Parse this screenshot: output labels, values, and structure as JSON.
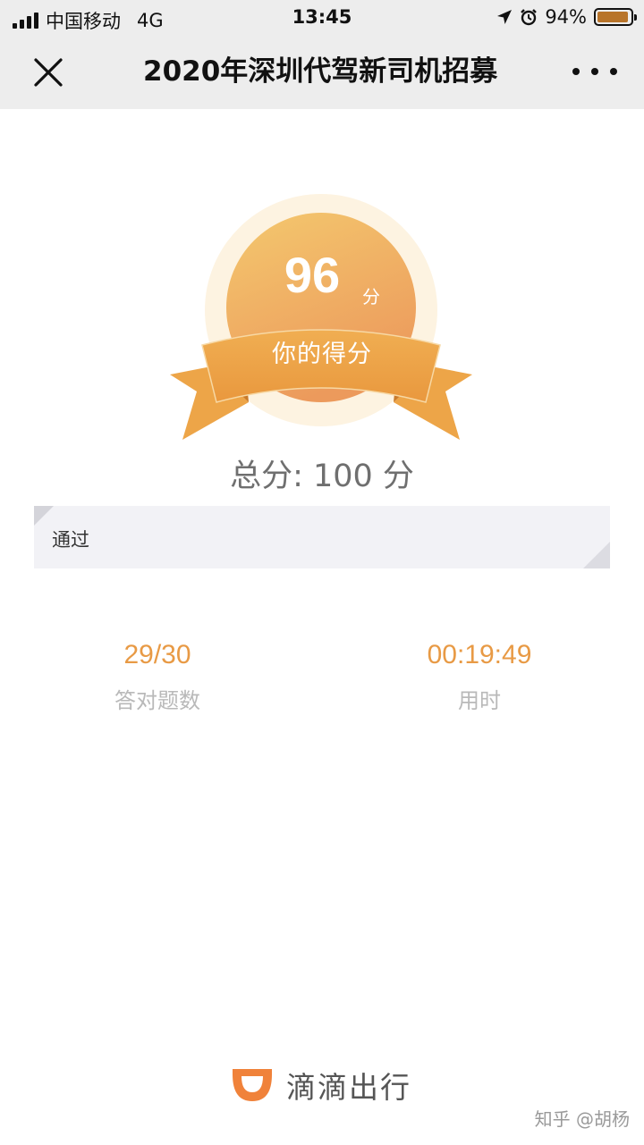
{
  "status_bar": {
    "carrier": "中国移动",
    "network": "4G",
    "time": "13:45",
    "battery": "94%",
    "battery_level": 0.94,
    "icons": [
      "signal-icon",
      "location-arrow-icon",
      "alarm-clock-icon",
      "battery-icon"
    ]
  },
  "nav": {
    "title": "2020年深圳代驾新司机招募",
    "close_icon": "close-icon",
    "more_icon": "more-dots-icon"
  },
  "score": {
    "value": "96",
    "unit": "分",
    "label": "你的得分",
    "total": "总分: 100 分"
  },
  "result": {
    "text": "通过"
  },
  "stats": [
    {
      "value": "29/30",
      "label": "答对题数"
    },
    {
      "value": "00:19:49",
      "label": "用时"
    }
  ],
  "footer": {
    "brand": "滴滴出行",
    "logo": "didi-logo-icon"
  },
  "watermark": "知乎 @胡杨",
  "colors": {
    "accent": "#e89a45",
    "ribbon": "#eda548",
    "medal_light": "#f4c86e",
    "medal_dark": "#ec9a5c",
    "halo": "#fdf3e1",
    "nav_bg": "#ededed",
    "brand_orange": "#f0823a"
  }
}
